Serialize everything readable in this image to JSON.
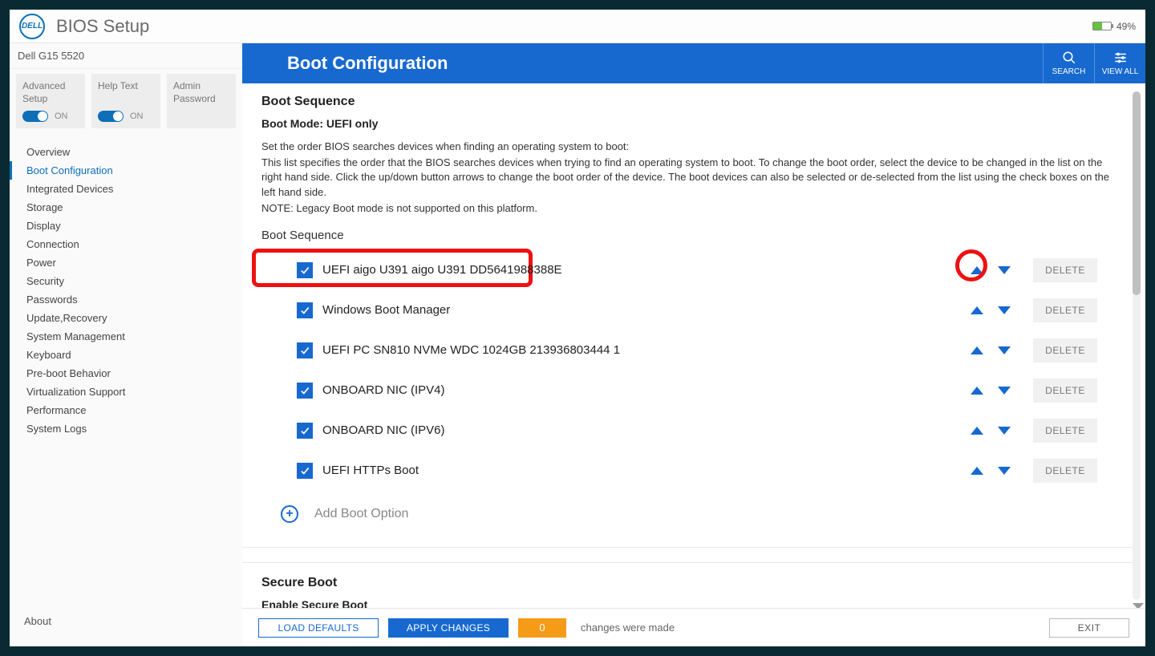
{
  "app_title": "BIOS Setup",
  "battery_percent": "49%",
  "model": "Dell G15 5520",
  "tiles": {
    "advanced": {
      "label": "Advanced Setup",
      "state": "ON"
    },
    "help": {
      "label": "Help Text",
      "state": "ON"
    },
    "admin": {
      "label": "Admin Password"
    }
  },
  "nav": [
    "Overview",
    "Boot Configuration",
    "Integrated Devices",
    "Storage",
    "Display",
    "Connection",
    "Power",
    "Security",
    "Passwords",
    "Update,Recovery",
    "System Management",
    "Keyboard",
    "Pre-boot Behavior",
    "Virtualization Support",
    "Performance",
    "System Logs"
  ],
  "nav_active_index": 1,
  "about_label": "About",
  "page_title": "Boot Configuration",
  "header_actions": {
    "search": "SEARCH",
    "viewall": "VIEW ALL"
  },
  "section": {
    "boot_sequence_heading": "Boot Sequence",
    "boot_mode": "Boot Mode: UEFI only",
    "desc_line1": "Set the order BIOS searches devices when finding an operating system to boot:",
    "desc_line2": "This list specifies the order that the BIOS searches devices when trying to find an operating system to boot.  To change the boot order, select the device to be changed in the list on the right hand side.  Click the up/down button arrows to change the boot order of the device.  The boot devices can also be selected or de-selected from the list using the check boxes on the left hand side.",
    "desc_note": "NOTE: Legacy Boot mode is not supported on this platform.",
    "list_label": "Boot Sequence"
  },
  "boot_items": [
    {
      "label": "UEFI aigo U391 aigo U391 DD5641988388E",
      "checked": true
    },
    {
      "label": "Windows Boot Manager",
      "checked": true
    },
    {
      "label": "UEFI PC SN810 NVMe WDC 1024GB 213936803444 1",
      "checked": true
    },
    {
      "label": "ONBOARD NIC (IPV4)",
      "checked": true
    },
    {
      "label": "ONBOARD NIC (IPV6)",
      "checked": true
    },
    {
      "label": "UEFI HTTPs Boot",
      "checked": true
    }
  ],
  "delete_label": "DELETE",
  "add_boot_label": "Add Boot Option",
  "secure_boot_heading": "Secure Boot",
  "enable_secure_boot_label": "Enable Secure Boot",
  "footer": {
    "load_defaults": "LOAD DEFAULTS",
    "apply_changes": "APPLY CHANGES",
    "changes_count": "0",
    "changes_text": "changes were made",
    "exit": "EXIT"
  }
}
